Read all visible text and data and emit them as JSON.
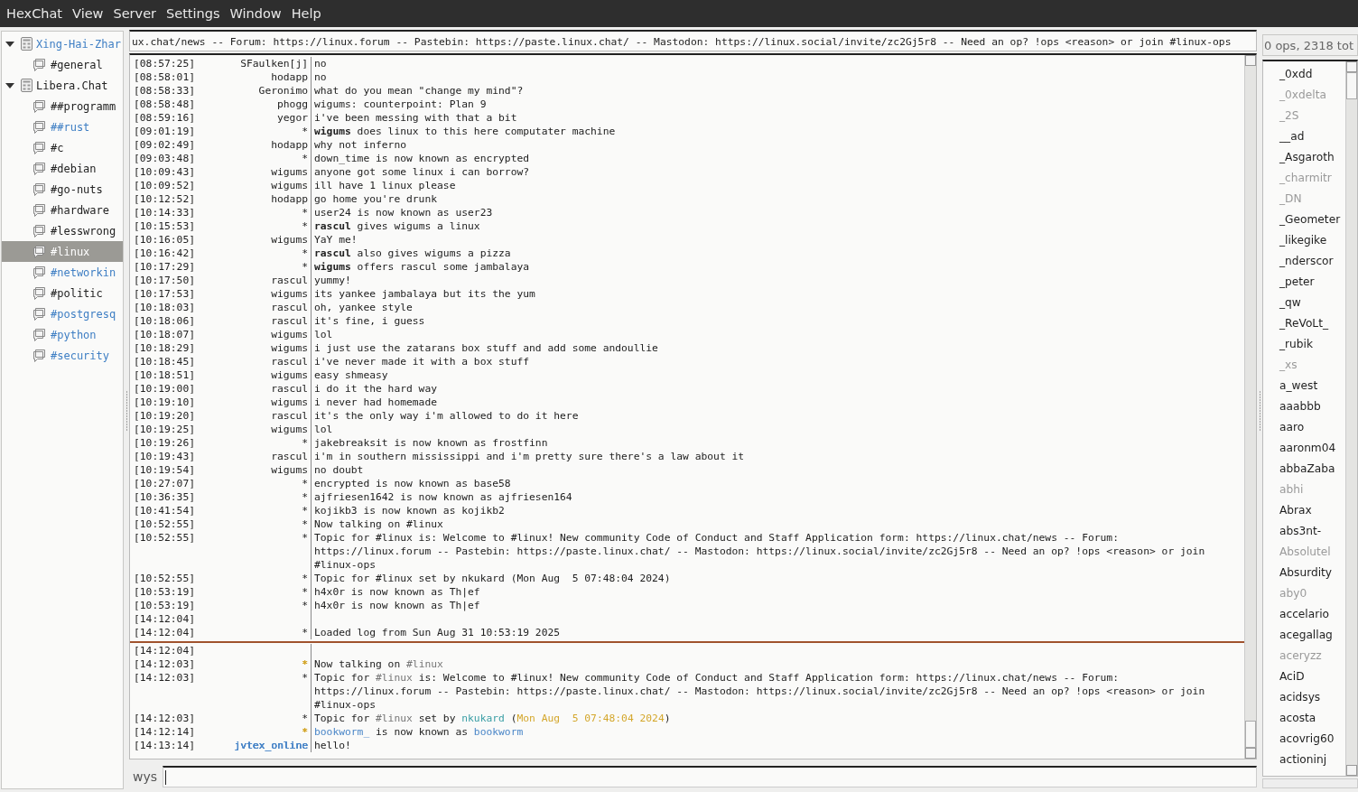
{
  "menu": [
    "HexChat",
    "View",
    "Server",
    "Settings",
    "Window",
    "Help"
  ],
  "servers": [
    {
      "name": "Xing-Hai-Zhar",
      "expanded": true,
      "new_activity": true,
      "selected": false,
      "channels": [
        {
          "name": "#general",
          "new_activity": false,
          "selected": false
        }
      ]
    },
    {
      "name": "Libera.Chat",
      "expanded": true,
      "new_activity": false,
      "selected": false,
      "channels": [
        {
          "name": "##programm",
          "new_activity": false,
          "selected": false
        },
        {
          "name": "##rust",
          "new_activity": true,
          "selected": false
        },
        {
          "name": "#c",
          "new_activity": false,
          "selected": false
        },
        {
          "name": "#debian",
          "new_activity": false,
          "selected": false
        },
        {
          "name": "#go-nuts",
          "new_activity": false,
          "selected": false
        },
        {
          "name": "#hardware",
          "new_activity": false,
          "selected": false
        },
        {
          "name": "#lesswrong",
          "new_activity": false,
          "selected": false
        },
        {
          "name": "#linux",
          "new_activity": false,
          "selected": true
        },
        {
          "name": "#networkin",
          "new_activity": true,
          "selected": false
        },
        {
          "name": "#politic",
          "new_activity": false,
          "selected": false
        },
        {
          "name": "#postgresq",
          "new_activity": true,
          "selected": false
        },
        {
          "name": "#python",
          "new_activity": true,
          "selected": false
        },
        {
          "name": "#security",
          "new_activity": true,
          "selected": false
        }
      ]
    }
  ],
  "topic": "ux.chat/news -- Forum: https://linux.forum -- Pastebin: https://paste.linux.chat/ -- Mastodon: https://linux.social/invite/zc2Gj5r8 -- Need an op? !ops <reason> or join #linux-ops",
  "chat": {
    "history": [
      {
        "time": "[08:57:25]",
        "nick": "SFaulken[j]",
        "text": "no"
      },
      {
        "time": "[08:58:01]",
        "nick": "hodapp",
        "text": "no"
      },
      {
        "time": "[08:58:33]",
        "nick": "Geronimo",
        "text": "what do you mean \"change my mind\"?"
      },
      {
        "time": "[08:58:48]",
        "nick": "phogg",
        "text": "wigums: counterpoint: Plan 9"
      },
      {
        "time": "[08:59:16]",
        "nick": "yegor",
        "text": "i've been messing with that a bit"
      },
      {
        "time": "[09:01:19]",
        "nick": "*",
        "text": "**wigums** does linux to this here computater machine"
      },
      {
        "time": "[09:02:49]",
        "nick": "hodapp",
        "text": "why not inferno"
      },
      {
        "time": "[09:03:48]",
        "nick": "*",
        "text": "down_time is now known as encrypted"
      },
      {
        "time": "[10:09:43]",
        "nick": "wigums",
        "text": "anyone got some linux i can borrow?"
      },
      {
        "time": "[10:09:52]",
        "nick": "wigums",
        "text": "ill have 1 linux please"
      },
      {
        "time": "[10:12:52]",
        "nick": "hodapp",
        "text": "go home you're drunk"
      },
      {
        "time": "[10:14:33]",
        "nick": "*",
        "text": "user24 is now known as user23"
      },
      {
        "time": "[10:15:53]",
        "nick": "*",
        "text": "**rascul** gives wigums a linux"
      },
      {
        "time": "[10:16:05]",
        "nick": "wigums",
        "text": "YaY me!"
      },
      {
        "time": "[10:16:42]",
        "nick": "*",
        "text": "**rascul** also gives wigums a pizza"
      },
      {
        "time": "[10:17:29]",
        "nick": "*",
        "text": "**wigums** offers rascul some jambalaya"
      },
      {
        "time": "[10:17:50]",
        "nick": "rascul",
        "text": "yummy!"
      },
      {
        "time": "[10:17:53]",
        "nick": "wigums",
        "text": "its yankee jambalaya but its the yum"
      },
      {
        "time": "[10:18:03]",
        "nick": "rascul",
        "text": "oh, yankee style"
      },
      {
        "time": "[10:18:06]",
        "nick": "rascul",
        "text": "it's fine, i guess"
      },
      {
        "time": "[10:18:07]",
        "nick": "wigums",
        "text": "lol"
      },
      {
        "time": "[10:18:29]",
        "nick": "wigums",
        "text": "i just use the zatarans box stuff and add some andoullie"
      },
      {
        "time": "[10:18:45]",
        "nick": "rascul",
        "text": "i've never made it with a box stuff"
      },
      {
        "time": "[10:18:51]",
        "nick": "wigums",
        "text": "easy shmeasy"
      },
      {
        "time": "[10:19:00]",
        "nick": "rascul",
        "text": "i do it the hard way"
      },
      {
        "time": "[10:19:10]",
        "nick": "wigums",
        "text": "i never had homemade"
      },
      {
        "time": "[10:19:20]",
        "nick": "rascul",
        "text": "it's the only way i'm allowed to do it here"
      },
      {
        "time": "[10:19:25]",
        "nick": "wigums",
        "text": "lol"
      },
      {
        "time": "[10:19:26]",
        "nick": "*",
        "text": "jakebreaksit is now known as frostfinn"
      },
      {
        "time": "[10:19:43]",
        "nick": "rascul",
        "text": "i'm in southern mississippi and i'm pretty sure there's a law about it"
      },
      {
        "time": "[10:19:54]",
        "nick": "wigums",
        "text": "no doubt"
      },
      {
        "time": "[10:27:07]",
        "nick": "*",
        "text": "encrypted is now known as base58"
      },
      {
        "time": "[10:36:35]",
        "nick": "*",
        "text": "ajfriesen1642 is now known as ajfriesen164"
      },
      {
        "time": "[10:41:54]",
        "nick": "*",
        "text": "kojikb3 is now known as kojikb2"
      },
      {
        "time": "[10:52:55]",
        "nick": "*",
        "text": "Now talking on #linux"
      },
      {
        "time": "[10:52:55]",
        "nick": "*",
        "text": "Topic for #linux is: Welcome to #linux! New community Code of Conduct and Staff Application form: https://linux.chat/news -- Forum: https://linux.forum -- Pastebin: https://paste.linux.chat/ -- Mastodon: https://linux.social/invite/zc2Gj5r8 -- Need an op? !ops <reason> or join #linux-ops"
      },
      {
        "time": "[10:52:55]",
        "nick": "*",
        "text": "Topic for #linux set by nkukard (Mon Aug  5 07:48:04 2024)"
      },
      {
        "time": "[10:53:19]",
        "nick": "*",
        "text": "h4x0r is now known as Th|ef"
      },
      {
        "time": "[10:53:19]",
        "nick": "*",
        "text": "h4x0r is now known as Th|ef"
      },
      {
        "time": "[14:12:04]"
      },
      {
        "time": "[14:12:04]",
        "nick": "*",
        "text": "Loaded log from Sun Aug 31 10:53:19 2025"
      }
    ],
    "recent": [
      {
        "time": "[14:12:04]"
      },
      {
        "time": "[14:12:03]",
        "nick": "*",
        "color": "#d4a72c",
        "parts": [
          {
            "text": "Now talking on "
          },
          {
            "text": "#linux",
            "color": "#777777"
          }
        ]
      },
      {
        "time": "[14:12:03]",
        "nick": "*",
        "parts": [
          {
            "text": "Topic for "
          },
          {
            "text": "#linux",
            "color": "#777777"
          },
          {
            "text": " is: Welcome to #linux! New community Code of Conduct and Staff Application form: https://linux.chat/news -- Forum: https://linux.forum -- Pastebin: https://paste.linux.chat/ -- Mastodon: https://linux.social/invite/zc2Gj5r8 -- Need an op? !ops <reason> or join #linux-ops"
          }
        ]
      },
      {
        "time": "[14:12:03]",
        "nick": "*",
        "parts": [
          {
            "text": "Topic for "
          },
          {
            "text": "#linux",
            "color": "#777777"
          },
          {
            "text": " set by "
          },
          {
            "text": "nkukard",
            "color": "#3a9ea5"
          },
          {
            "text": " ("
          },
          {
            "text": "Mon Aug  5 07:48:04 2024",
            "color": "#d4a72c"
          },
          {
            "text": ")"
          }
        ]
      },
      {
        "time": "[14:12:14]",
        "nick": "*",
        "color": "#d4a72c",
        "parts": [
          {
            "text": "bookworm_",
            "color": "#4a86c8"
          },
          {
            "text": " is now known as "
          },
          {
            "text": "bookworm",
            "color": "#4a86c8"
          }
        ]
      },
      {
        "time": "[14:13:14]",
        "nick": "jvtex_online",
        "color": "#4a86c8",
        "text": "hello!"
      }
    ]
  },
  "input": {
    "nick": "wys"
  },
  "users": {
    "header": "0 ops, 2318 tot",
    "list": [
      {
        "name": "_0xdd",
        "away": false
      },
      {
        "name": "_0xdelta",
        "away": true
      },
      {
        "name": "_2S",
        "away": true
      },
      {
        "name": "__ad",
        "away": false
      },
      {
        "name": "_Asgaroth",
        "away": false
      },
      {
        "name": "_charmitr",
        "away": true
      },
      {
        "name": "_DN",
        "away": true
      },
      {
        "name": "_Geometer",
        "away": false
      },
      {
        "name": "_likegike",
        "away": false
      },
      {
        "name": "_nderscor",
        "away": false
      },
      {
        "name": "_peter",
        "away": false
      },
      {
        "name": "_qw",
        "away": false
      },
      {
        "name": "_ReVoLt_",
        "away": false
      },
      {
        "name": "_rubik",
        "away": false
      },
      {
        "name": "_xs",
        "away": true
      },
      {
        "name": "a_west",
        "away": false
      },
      {
        "name": "aaabbb",
        "away": false
      },
      {
        "name": "aaro",
        "away": false
      },
      {
        "name": "aaronm04",
        "away": false
      },
      {
        "name": "abbaZaba",
        "away": false
      },
      {
        "name": "abhi",
        "away": true
      },
      {
        "name": "Abrax",
        "away": false
      },
      {
        "name": "abs3nt-",
        "away": false
      },
      {
        "name": "Absolutel",
        "away": true
      },
      {
        "name": "Absurdity",
        "away": false
      },
      {
        "name": "aby0",
        "away": true
      },
      {
        "name": "accelario",
        "away": false
      },
      {
        "name": "acegallag",
        "away": false
      },
      {
        "name": "aceryzz",
        "away": true
      },
      {
        "name": "AciD",
        "away": false
      },
      {
        "name": "acidsys",
        "away": false
      },
      {
        "name": "acosta",
        "away": false
      },
      {
        "name": "acovrig60",
        "away": false
      },
      {
        "name": "actioninj",
        "away": false
      }
    ]
  }
}
